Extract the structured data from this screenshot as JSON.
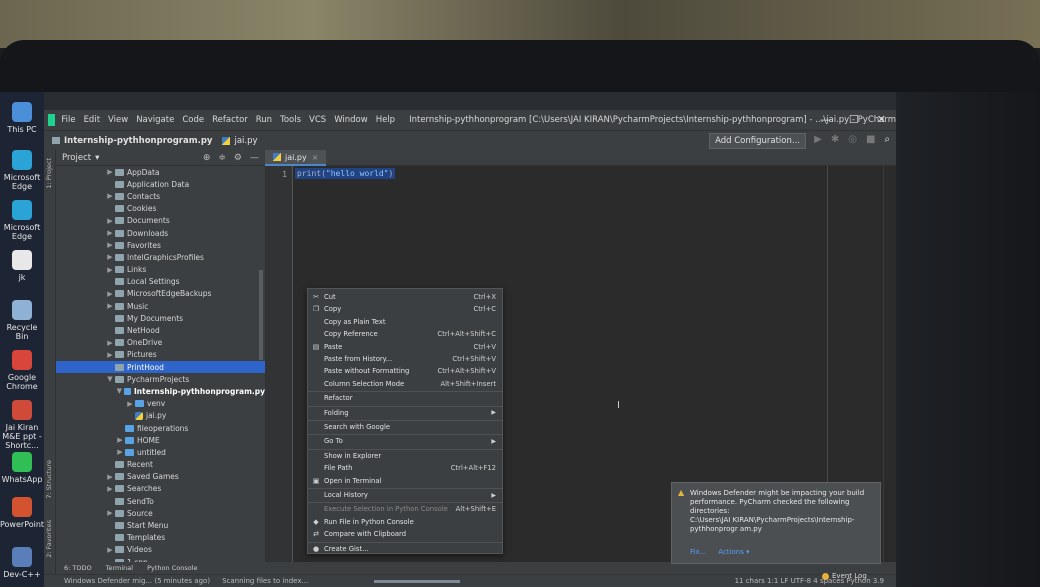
{
  "desktop": {
    "icons": [
      {
        "label": "This PC",
        "icon": "computer-icon",
        "color": "#4a8fd8"
      },
      {
        "label": "Microsoft Edge",
        "icon": "edge-icon",
        "color": "#2aa3d6"
      },
      {
        "label": "Microsoft Edge",
        "icon": "edge-icon",
        "color": "#2aa3d6"
      },
      {
        "label": "jk",
        "icon": "file-icon",
        "color": "#e8e8e8"
      },
      {
        "label": "Recycle Bin",
        "icon": "recycle-bin-icon",
        "color": "#8fb1d6"
      },
      {
        "label": "Google Chrome",
        "icon": "chrome-icon",
        "color": "#d9453a"
      },
      {
        "label": "Jai Kiran M&E ppt - Shortc...",
        "icon": "pdf-icon",
        "color": "#d04a3a"
      },
      {
        "label": "WhatsApp",
        "icon": "whatsapp-icon",
        "color": "#2fbf54"
      },
      {
        "label": "PowerPoint",
        "icon": "powerpoint-icon",
        "color": "#d35230"
      },
      {
        "label": "Dev-C++",
        "icon": "devcpp-icon",
        "color": "#5a7fb8"
      }
    ]
  },
  "menubar": {
    "items": [
      "File",
      "Edit",
      "View",
      "Navigate",
      "Code",
      "Refactor",
      "Run",
      "Tools",
      "VCS",
      "Window",
      "Help"
    ],
    "title": "Internship-pythhonprogram [C:\\Users\\JAI KIRAN\\PycharmProjects\\Internship-pythhonprogram] - ...\\jai.py - PyCharm"
  },
  "navbar": {
    "project_crumb": "Internship-pythhonprogram.py",
    "file_crumb": "jai.py",
    "add_config_label": "Add Configuration..."
  },
  "project_panel": {
    "title": "Project",
    "tree": [
      {
        "label": "AppData",
        "indent": 5,
        "arrow": "▶"
      },
      {
        "label": "Application Data",
        "indent": 5,
        "arrow": ""
      },
      {
        "label": "Contacts",
        "indent": 5,
        "arrow": "▶"
      },
      {
        "label": "Cookies",
        "indent": 5,
        "arrow": ""
      },
      {
        "label": "Documents",
        "indent": 5,
        "arrow": "▶"
      },
      {
        "label": "Downloads",
        "indent": 5,
        "arrow": "▶"
      },
      {
        "label": "Favorites",
        "indent": 5,
        "arrow": "▶"
      },
      {
        "label": "IntelGraphicsProfiles",
        "indent": 5,
        "arrow": "▶"
      },
      {
        "label": "Links",
        "indent": 5,
        "arrow": "▶"
      },
      {
        "label": "Local Settings",
        "indent": 5,
        "arrow": ""
      },
      {
        "label": "MicrosoftEdgeBackups",
        "indent": 5,
        "arrow": "▶"
      },
      {
        "label": "Music",
        "indent": 5,
        "arrow": "▶"
      },
      {
        "label": "My Documents",
        "indent": 5,
        "arrow": ""
      },
      {
        "label": "NetHood",
        "indent": 5,
        "arrow": ""
      },
      {
        "label": "OneDrive",
        "indent": 5,
        "arrow": "▶"
      },
      {
        "label": "Pictures",
        "indent": 5,
        "arrow": "▶"
      },
      {
        "label": "PrintHood",
        "indent": 5,
        "arrow": "",
        "selected": true
      },
      {
        "label": "PycharmProjects",
        "indent": 5,
        "arrow": "▼"
      },
      {
        "label": "Internship-pythhonprogram.py",
        "indent": 6,
        "arrow": "▼",
        "bold": true
      },
      {
        "label": "venv",
        "indent": 7,
        "arrow": "▶"
      },
      {
        "label": "jai.py",
        "indent": 7,
        "arrow": "",
        "file": true
      },
      {
        "label": "fileoperations",
        "indent": 6,
        "arrow": ""
      },
      {
        "label": "HOME",
        "indent": 6,
        "arrow": "▶"
      },
      {
        "label": "untitled",
        "indent": 6,
        "arrow": "▶"
      },
      {
        "label": "Recent",
        "indent": 5,
        "arrow": ""
      },
      {
        "label": "Saved Games",
        "indent": 5,
        "arrow": "▶"
      },
      {
        "label": "Searches",
        "indent": 5,
        "arrow": "▶"
      },
      {
        "label": "SendTo",
        "indent": 5,
        "arrow": ""
      },
      {
        "label": "Source",
        "indent": 5,
        "arrow": "▶"
      },
      {
        "label": "Start Menu",
        "indent": 5,
        "arrow": ""
      },
      {
        "label": "Templates",
        "indent": 5,
        "arrow": ""
      },
      {
        "label": "Videos",
        "indent": 5,
        "arrow": "▶"
      },
      {
        "label": "1.cpp",
        "indent": 5,
        "arrow": ""
      }
    ]
  },
  "side_tabs": {
    "project": "1: Project",
    "structure": "7: Structure",
    "favorites": "2: Favorites"
  },
  "editor": {
    "tab_label": "jai.py",
    "line_number": "1",
    "code_func": "print(",
    "code_str": "\"hello world\"",
    "code_end": ")"
  },
  "context_menu": {
    "items": [
      {
        "label": "Cut",
        "shortcut": "Ctrl+X",
        "icon": "cut-icon"
      },
      {
        "label": "Copy",
        "shortcut": "Ctrl+C",
        "icon": "copy-icon"
      },
      {
        "label": "Copy as Plain Text",
        "shortcut": ""
      },
      {
        "label": "Copy Reference",
        "shortcut": "Ctrl+Alt+Shift+C"
      },
      {
        "label": "Paste",
        "shortcut": "Ctrl+V",
        "icon": "paste-icon"
      },
      {
        "label": "Paste from History...",
        "shortcut": "Ctrl+Shift+V"
      },
      {
        "label": "Paste without Formatting",
        "shortcut": "Ctrl+Alt+Shift+V"
      },
      {
        "label": "Column Selection Mode",
        "shortcut": "Alt+Shift+Insert"
      },
      {
        "label": "Refactor",
        "shortcut": "",
        "sep_before": true
      },
      {
        "label": "Folding",
        "shortcut": "",
        "submenu": true,
        "sep_before": true
      },
      {
        "label": "Search with Google",
        "shortcut": "",
        "sep_before": true
      },
      {
        "label": "Go To",
        "shortcut": "",
        "submenu": true,
        "sep_before": true
      },
      {
        "label": "Show in Explorer",
        "shortcut": "",
        "sep_before": true
      },
      {
        "label": "File Path",
        "shortcut": "Ctrl+Alt+F12"
      },
      {
        "label": "Open in Terminal",
        "shortcut": "",
        "icon": "terminal-icon"
      },
      {
        "label": "Local History",
        "shortcut": "",
        "submenu": true,
        "sep_before": true
      },
      {
        "label": "Execute Selection in Python Console",
        "shortcut": "Alt+Shift+E",
        "disabled": true,
        "sep_before": true
      },
      {
        "label": "Run File in Python Console",
        "shortcut": "",
        "icon": "python-icon"
      },
      {
        "label": "Compare with Clipboard",
        "shortcut": "",
        "icon": "compare-icon"
      },
      {
        "label": "Create Gist...",
        "shortcut": "",
        "icon": "github-icon",
        "sep_before": true
      }
    ]
  },
  "notification": {
    "text": "Windows Defender might be impacting your build performance. PyCharm checked the following directories:",
    "path": "C:\\Users\\JAI KIRAN\\PycharmProjects\\Internship-pythhonprogr am.py",
    "fix_label": "Fix...",
    "actions_label": "Actions ▾"
  },
  "bottom_tools": {
    "todo": "6: TODO",
    "terminal": "Terminal",
    "python_console": "Python Console",
    "event_log": "Event Log"
  },
  "statusbar": {
    "message": "Windows Defender mig... (5 minutes ago)",
    "indexing": "Scanning files to index...",
    "position": "11 chars   1:1   LF   UTF-8   4 spaces   Python 3.9"
  }
}
